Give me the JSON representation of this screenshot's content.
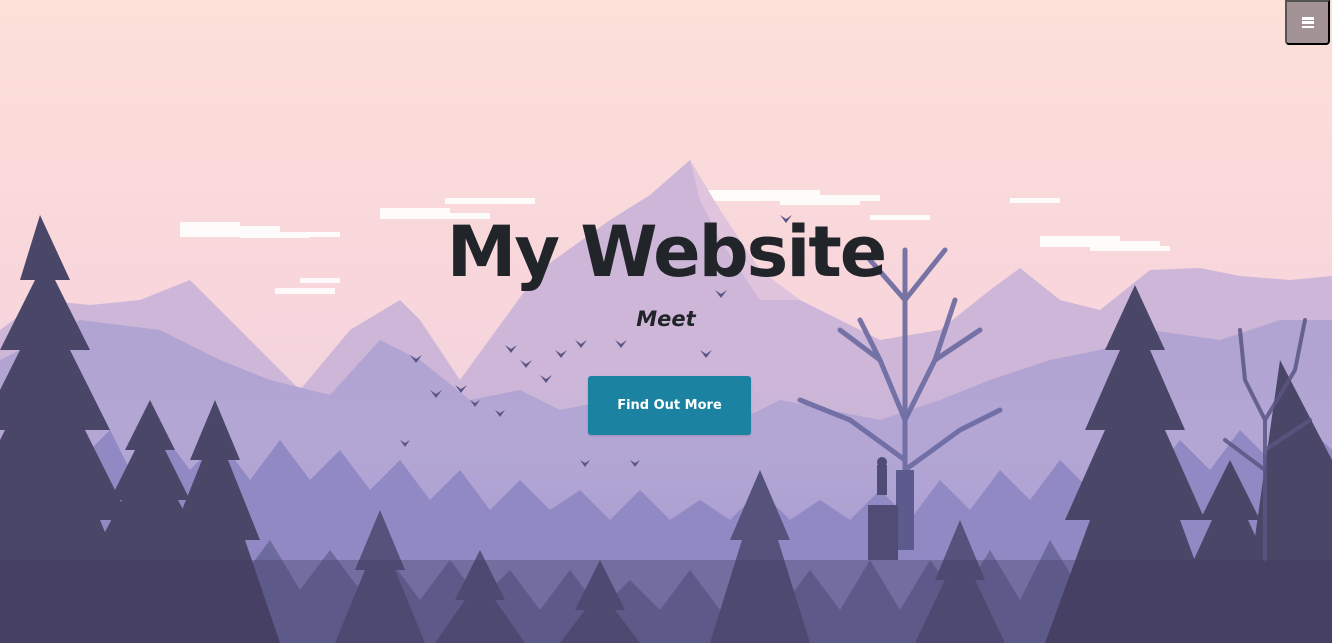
{
  "header": {
    "menu_icon": "hamburger-menu-icon"
  },
  "hero": {
    "title": "My Website",
    "subtitle": "Meet",
    "cta_label": "Find Out More",
    "background_image": "mountain-forest-landscape-illustration"
  },
  "colors": {
    "cta_background": "#1b83a1",
    "cta_text": "#ffffff",
    "heading_text": "#212529",
    "menu_toggle_background": "#6e646e"
  }
}
